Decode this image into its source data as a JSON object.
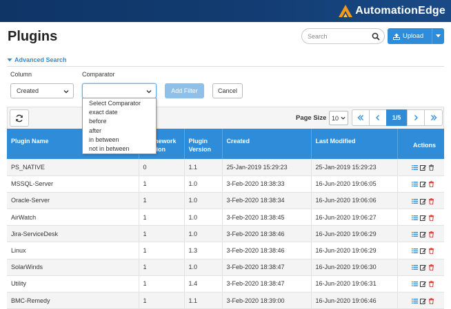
{
  "brand": {
    "name": "AutomationEdge",
    "accent": "#2f8cd8",
    "header_bg": "#123c72"
  },
  "page": {
    "title": "Plugins"
  },
  "search": {
    "placeholder": "Search",
    "icon": "search-icon"
  },
  "upload": {
    "label": "Upload",
    "icon": "upload-icon"
  },
  "advanced_search": {
    "label": "Advanced Search",
    "column_label": "Column",
    "column_value": "Created",
    "comparator_label": "Comparator",
    "comparator_value": "",
    "add_filter_label": "Add Filter",
    "cancel_label": "Cancel",
    "comparator_options": [
      "Select Comparator",
      "exact date",
      "before",
      "after",
      "in between",
      "not in between"
    ]
  },
  "toolbar": {
    "page_size_label": "Page Size",
    "page_size_value": "10",
    "current_page": "1/5"
  },
  "table": {
    "headers": {
      "plugin_name": "Plugin Name",
      "framework_version": "Framework Version",
      "plugin_version": "Plugin Version",
      "created": "Created",
      "last_modified": "Last Modified",
      "actions": "Actions"
    },
    "rows": [
      {
        "name": "PS_NATIVE",
        "framework": "0",
        "version": "1.1",
        "created": "25-Jan-2019 15:29:23",
        "modified": "25-Jan-2019 15:29:23",
        "delete_color": "#555555"
      },
      {
        "name": "MSSQL-Server",
        "framework": "1",
        "version": "1.0",
        "created": "3-Feb-2020 18:38:33",
        "modified": "16-Jun-2020 19:06:05",
        "delete_color": "#d9342b"
      },
      {
        "name": "Oracle-Server",
        "framework": "1",
        "version": "1.0",
        "created": "3-Feb-2020 18:38:34",
        "modified": "16-Jun-2020 19:06:06",
        "delete_color": "#d9342b"
      },
      {
        "name": "AirWatch",
        "framework": "1",
        "version": "1.0",
        "created": "3-Feb-2020 18:38:45",
        "modified": "16-Jun-2020 19:06:27",
        "delete_color": "#d9342b"
      },
      {
        "name": "Jira-ServiceDesk",
        "framework": "1",
        "version": "1.0",
        "created": "3-Feb-2020 18:38:46",
        "modified": "16-Jun-2020 19:06:29",
        "delete_color": "#d9342b"
      },
      {
        "name": "Linux",
        "framework": "1",
        "version": "1.3",
        "created": "3-Feb-2020 18:38:46",
        "modified": "16-Jun-2020 19:06:29",
        "delete_color": "#d9342b"
      },
      {
        "name": "SolarWinds",
        "framework": "1",
        "version": "1.0",
        "created": "3-Feb-2020 18:38:47",
        "modified": "16-Jun-2020 19:06:30",
        "delete_color": "#d9342b"
      },
      {
        "name": "Utility",
        "framework": "1",
        "version": "1.4",
        "created": "3-Feb-2020 18:38:47",
        "modified": "16-Jun-2020 19:06:31",
        "delete_color": "#d9342b"
      },
      {
        "name": "BMC-Remedy",
        "framework": "1",
        "version": "1.1",
        "created": "3-Feb-2020 18:39:00",
        "modified": "16-Jun-2020 19:06:46",
        "delete_color": "#d9342b"
      }
    ]
  }
}
